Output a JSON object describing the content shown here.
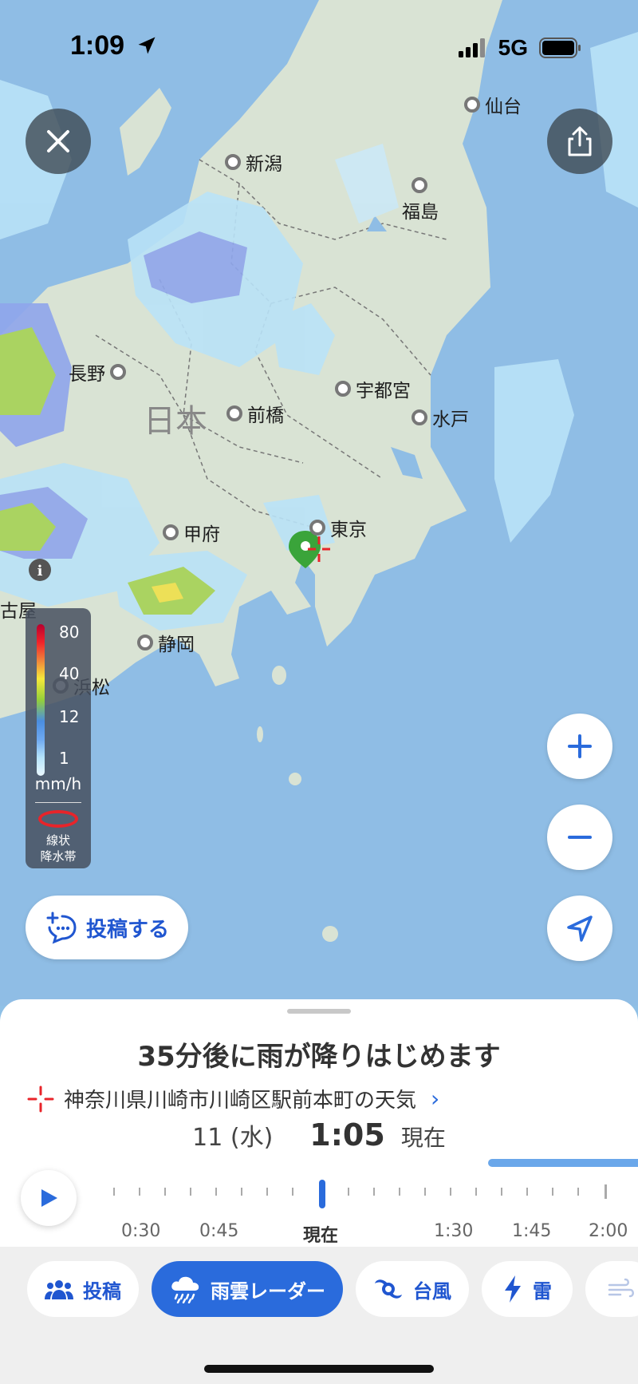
{
  "status": {
    "time": "1:09",
    "network": "5G"
  },
  "map": {
    "country_label": "日本",
    "cities": [
      {
        "name": "仙台"
      },
      {
        "name": "新潟"
      },
      {
        "name": "福島"
      },
      {
        "name": "長野"
      },
      {
        "name": "宇都宮"
      },
      {
        "name": "前橋"
      },
      {
        "name": "水戸"
      },
      {
        "name": "甲府"
      },
      {
        "name": "東京"
      },
      {
        "name": "静岡"
      },
      {
        "name": "浜松"
      },
      {
        "name": "古屋"
      }
    ]
  },
  "legend": {
    "values": [
      "80",
      "40",
      "12",
      "1"
    ],
    "unit": "mm/h",
    "band_label_1": "線状",
    "band_label_2": "降水帯"
  },
  "post_button": {
    "label": "投稿する"
  },
  "sheet": {
    "headline": "35分後に雨が降りはじめます",
    "location": "神奈川県川崎市川崎区駅前本町の天気",
    "day": "11 (水)",
    "time": "1:05",
    "now_label": "現在",
    "progress_fraction": 0.28,
    "timeline_labels": [
      "0:30",
      "0:45",
      "現在",
      "1:30",
      "1:45",
      "2:00"
    ]
  },
  "tabs": [
    {
      "label": "投稿",
      "icon": "people-icon"
    },
    {
      "label": "雨雲レーダー",
      "icon": "rain-cloud-icon",
      "active": true
    },
    {
      "label": "台風",
      "icon": "typhoon-icon"
    },
    {
      "label": "雷",
      "icon": "lightning-icon"
    }
  ],
  "colors": {
    "accent": "#2a6bdc",
    "sea": "#8fbde5",
    "land": "#d9e3d4",
    "rain_light": "#b9e2f7",
    "rain_mid": "#6d8fe6",
    "rain_heavy": "#9ccf4a"
  }
}
